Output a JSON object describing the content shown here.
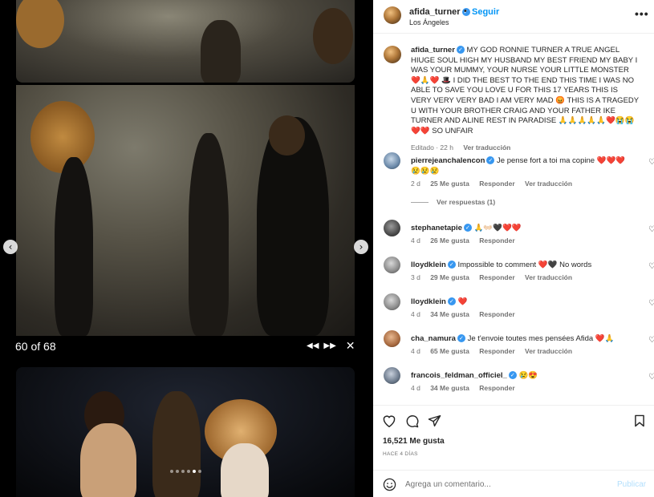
{
  "header": {
    "username": "afida_turner",
    "separator": "•",
    "follow_label": "Seguir",
    "location": "Los Ángeles",
    "more_label": "•••"
  },
  "media": {
    "counter": "60 of 68",
    "prev_glyph": "‹",
    "next_glyph": "›",
    "rewind_glyph": "◀◀",
    "forward_glyph": "▶▶",
    "close_glyph": "✕",
    "slide_count": 6,
    "active_slide": 5
  },
  "caption": {
    "username": "afida_turner",
    "text": "MY GOD RONNIE TURNER A TRUE ANGEL HIUGE SOUL HIGH MY HUSBAND MY BEST FRIEND MY BABY I WAS YOUR MUMMY, YOUR NURSE YOUR LITTLE MONSTER ❤️🙏❤️ 🎩 I DID THE BEST TO THE END THIS TIME I WAS NO ABLE TO SAVE YOU LOVE U FOR THIS 17 YEARS THIS IS VERY VERY VERY BAD I AM VERY MAD 😡 THIS IS A TRAGEDY U WITH YOUR BROTHER CRAIG AND YOUR FATHER IKE TURNER AND ALINE REST IN PARADISE 🙏🙏🙏🙏🙏❤️😭😭❤️❤️ SO UNFAIR",
    "edited": "Editado · 22 h",
    "translate": "Ver traducción"
  },
  "comments": [
    {
      "username": "pierrejeanchalencon",
      "text": "Je pense fort a toi ma copine ❤️❤️❤️ 😢😢😢",
      "age": "2 d",
      "likes": "25 Me gusta",
      "reply": "Responder",
      "translate": "Ver traducción"
    },
    {
      "username": "stephanetapie",
      "text": "🙏👐🏻🖤❤️❤️",
      "age": "4 d",
      "likes": "26 Me gusta",
      "reply": "Responder",
      "translate": ""
    },
    {
      "username": "lloydklein",
      "text": "Impossible to comment ❤️🖤 No words",
      "age": "3 d",
      "likes": "29 Me gusta",
      "reply": "Responder",
      "translate": "Ver traducción"
    },
    {
      "username": "lloydklein",
      "text": "❤️",
      "age": "4 d",
      "likes": "34 Me gusta",
      "reply": "Responder",
      "translate": ""
    },
    {
      "username": "cha_namura",
      "text": "Je t'envoie toutes mes pensées Afida ❤️🙏",
      "age": "4 d",
      "likes": "65 Me gusta",
      "reply": "Responder",
      "translate": "Ver traducción"
    },
    {
      "username": "francois_feldman_officiel_",
      "text": "😢😍",
      "age": "4 d",
      "likes": "34 Me gusta",
      "reply": "Responder",
      "translate": ""
    }
  ],
  "view_replies": "Ver respuestas (1)",
  "actions": {
    "likes": "16,521 Me gusta",
    "posted_ago": "HACE 4 DÍAS",
    "comment_placeholder": "Agrega un comentario...",
    "publish_label": "Publicar"
  },
  "colors": {
    "accent": "#0095f6",
    "verified": "#3797f0",
    "heart": "#e0245e",
    "muted": "#737373"
  }
}
